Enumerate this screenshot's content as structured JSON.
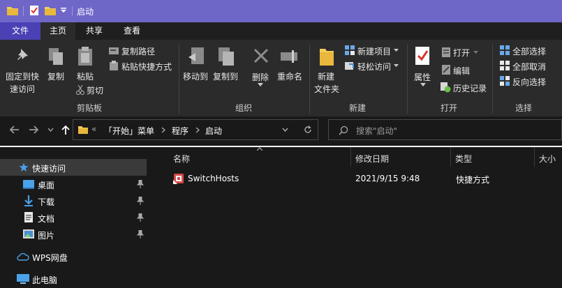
{
  "window": {
    "title": "启动"
  },
  "ribbon_tabs": [
    "文件",
    "主页",
    "共享",
    "查看"
  ],
  "clipboard": {
    "pin_quick_access": [
      "固定到快",
      "速访问"
    ],
    "copy": "复制",
    "paste": "粘贴",
    "copy_path": "复制路径",
    "paste_shortcut": "粘贴快捷方式",
    "cut": "剪切",
    "group": "剪贴板"
  },
  "organize": {
    "move_to": "移动到",
    "copy_to": "复制到",
    "delete": "删除",
    "rename": "重命名",
    "group": "组织"
  },
  "new": {
    "new_folder": [
      "新建",
      "文件夹"
    ],
    "new_item": "新建项目",
    "easy_access": "轻松访问",
    "group": "新建"
  },
  "open": {
    "properties": "属性",
    "open": "打开",
    "edit": "编辑",
    "history": "历史记录",
    "group": "打开"
  },
  "select": {
    "select_all": "全部选择",
    "select_none": "全部取消",
    "invert": "反向选择",
    "group": "选择"
  },
  "address": {
    "overflow": "«",
    "crumbs": [
      "「开始」菜单",
      "程序",
      "启动"
    ]
  },
  "search": {
    "placeholder": "搜索\"启动\""
  },
  "nav": {
    "quick_access": "快速访问",
    "items": [
      "桌面",
      "下载",
      "文档",
      "图片"
    ],
    "wps": "WPS网盘",
    "this_pc": "此电脑"
  },
  "columns": {
    "name": "名称",
    "date": "修改日期",
    "type": "类型",
    "size": "大小"
  },
  "files": [
    {
      "name": "SwitchHosts",
      "date": "2021/9/15 9:48",
      "type": "快捷方式"
    }
  ],
  "colors": {
    "title_bar": "#6f67c8",
    "file_tab": "#4a41b5",
    "ribbon": "#2b2b2b",
    "background": "#191919"
  }
}
